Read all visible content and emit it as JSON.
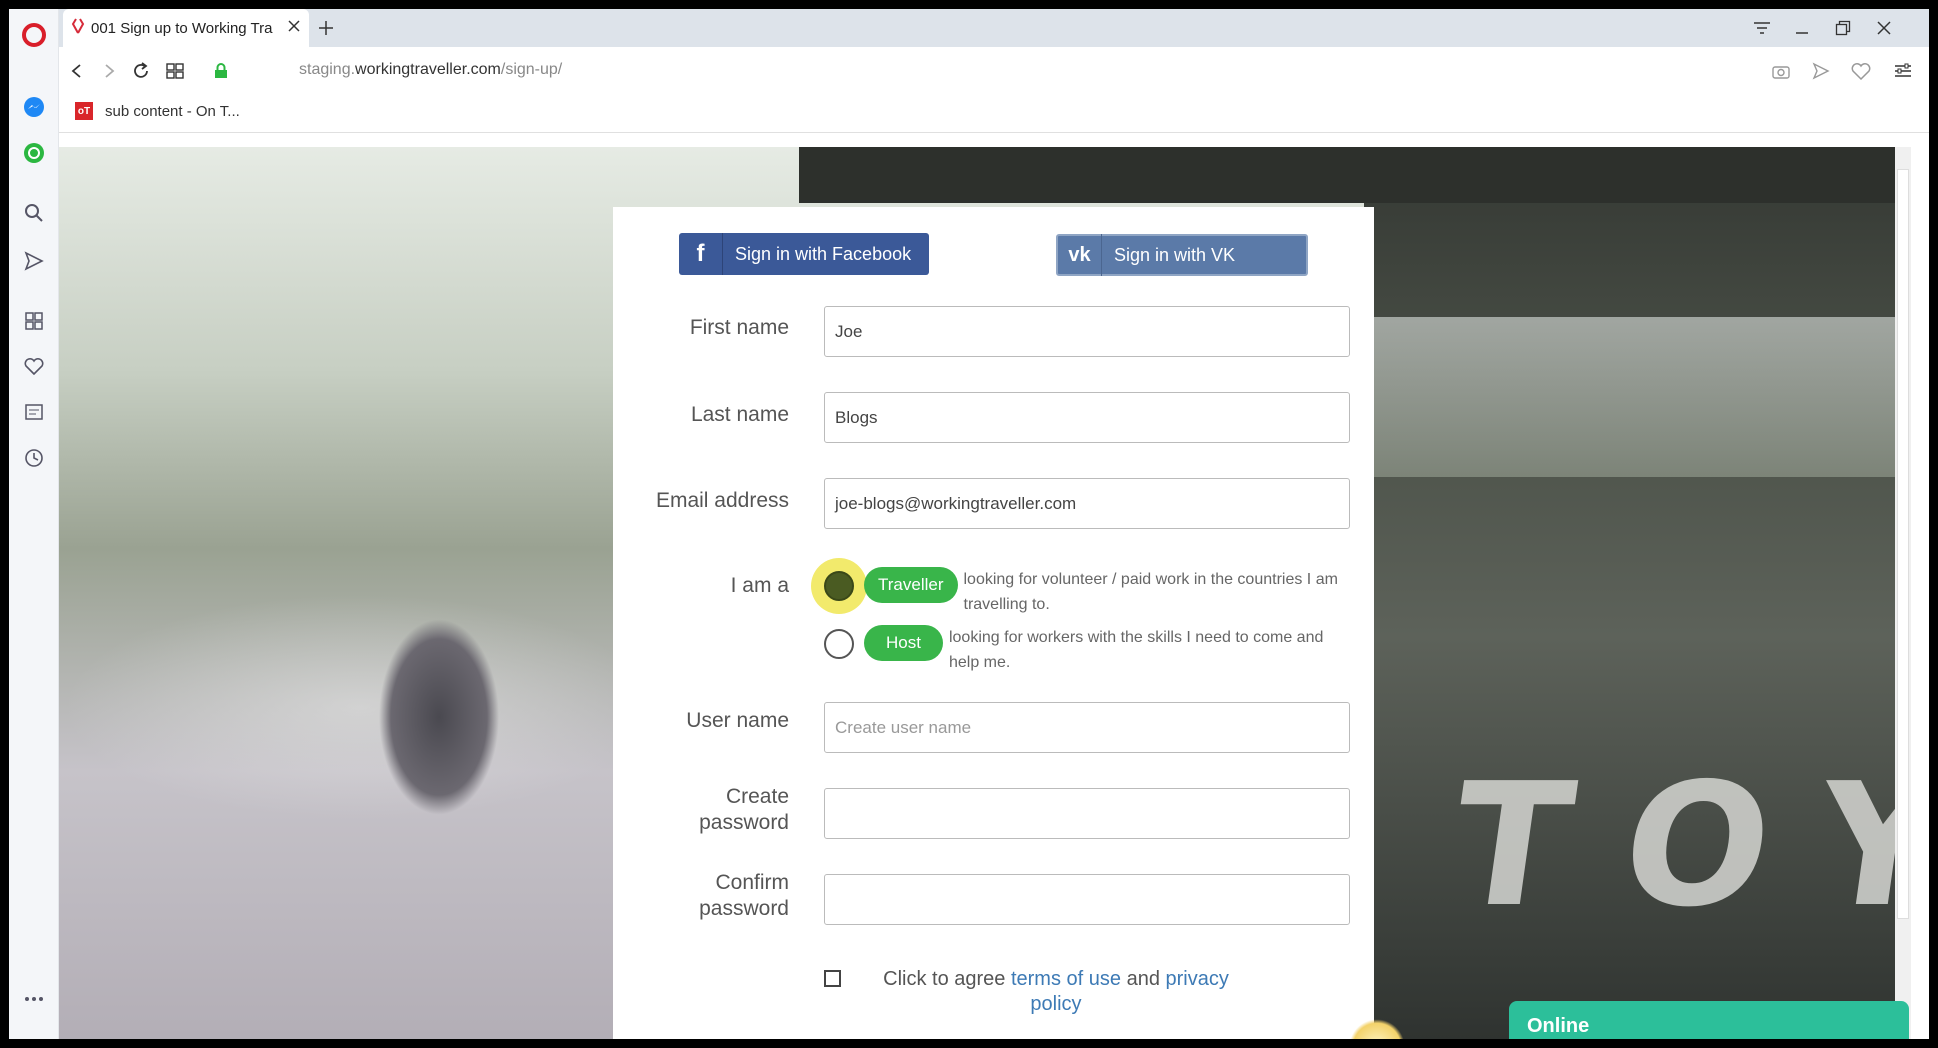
{
  "browser": {
    "tab_title": "001 Sign up to Working Tra",
    "url_prefix": "staging.",
    "url_domain": "workingtraveller.com",
    "url_path": "/sign-up/",
    "bookmark_label": "sub content - On T...",
    "bookmark_icon_text": "oT"
  },
  "social": {
    "facebook_label": "Sign in with Facebook",
    "vk_label": "Sign in with VK"
  },
  "form": {
    "first_name_label": "First name",
    "first_name_value": "Joe",
    "last_name_label": "Last name",
    "last_name_value": "Blogs",
    "email_label": "Email address",
    "email_value": "joe-blogs@workingtraveller.com",
    "iam_label": "I am a",
    "roles": [
      {
        "label": "Traveller",
        "desc": "looking for volunteer / paid work in the countries I am travelling to.",
        "selected": true
      },
      {
        "label": "Host",
        "desc": "looking for workers with the skills I need to come and help me.",
        "selected": false
      }
    ],
    "username_label": "User name",
    "username_placeholder": "Create user name",
    "create_password_label_1": "Create",
    "create_password_label_2": "password",
    "confirm_password_label_1": "Confirm",
    "confirm_password_label_2": "password",
    "agree_prefix": "Click to agree",
    "terms_link": "terms of use",
    "agree_and": "and",
    "privacy_link": "privacy policy"
  },
  "background": {
    "truck_text": "TOYOT"
  },
  "chat": {
    "status": "Online"
  },
  "colors": {
    "facebook": "#3b5998",
    "vk": "#5b7aa8",
    "pill_green": "#39b54a",
    "chat_teal": "#2cbf9a",
    "link_blue": "#3d7ab5"
  }
}
